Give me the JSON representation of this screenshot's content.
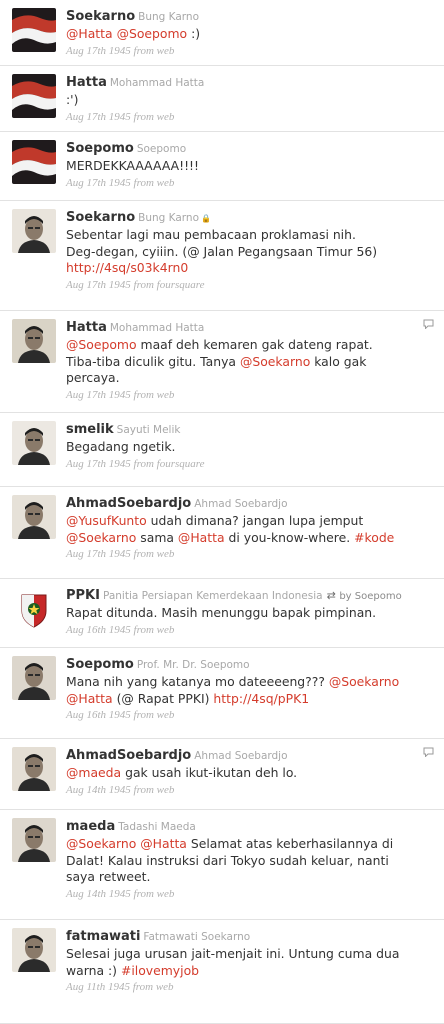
{
  "tweets": [
    {
      "username": "Soekarno",
      "fullname": "Bung Karno",
      "parts": [
        {
          "t": "mention",
          "v": "@Hatta"
        },
        {
          "t": "text",
          "v": " "
        },
        {
          "t": "mention",
          "v": "@Soepomo"
        },
        {
          "t": "text",
          "v": " :)"
        }
      ],
      "meta": "Aug 17th 1945 from web",
      "avatar": "flag-avatar"
    },
    {
      "username": "Hatta",
      "fullname": "Mohammad Hatta",
      "parts": [
        {
          "t": "text",
          "v": ":')"
        }
      ],
      "meta": "Aug 17th 1945 from web",
      "avatar": "flag-avatar"
    },
    {
      "username": "Soepomo",
      "fullname": "Soepomo",
      "parts": [
        {
          "t": "text",
          "v": "MERDEKKAAAAAA!!!!"
        }
      ],
      "meta": "Aug 17th 1945 from web",
      "avatar": "flag-avatar"
    },
    {
      "username": "Soekarno",
      "fullname": "Bung Karno",
      "locked": true,
      "parts": [
        {
          "t": "text",
          "v": "Sebentar lagi mau pembacaan proklamasi nih.\nDeg-degan, cyiiin. (@ Jalan Pegangsaan Timur 56)\n"
        },
        {
          "t": "link",
          "v": "http://4sq/s03k4rn0"
        }
      ],
      "meta": "Aug 17th 1945 from foursquare",
      "avatar": "portrait-avatar"
    },
    {
      "username": "Hatta",
      "fullname": "Mohammad Hatta",
      "reply": true,
      "parts": [
        {
          "t": "mention",
          "v": "@Soepomo"
        },
        {
          "t": "text",
          "v": " maaf deh kemaren gak dateng rapat.\nTiba-tiba diculik gitu. Tanya "
        },
        {
          "t": "mention",
          "v": "@Soekarno"
        },
        {
          "t": "text",
          "v": " kalo gak\npercaya."
        }
      ],
      "meta": "Aug 17th 1945 from web",
      "avatar": "portrait-avatar"
    },
    {
      "username": "smelik",
      "fullname": "Sayuti Melik",
      "parts": [
        {
          "t": "text",
          "v": "Begadang ngetik."
        }
      ],
      "meta": "Aug 17th 1945 from foursquare",
      "avatar": "portrait-avatar"
    },
    {
      "username": "AhmadSoebardjo",
      "fullname": "Ahmad Soebardjo",
      "parts": [
        {
          "t": "mention",
          "v": "@YusufKunto"
        },
        {
          "t": "text",
          "v": " udah dimana? jangan lupa jemput\n"
        },
        {
          "t": "mention",
          "v": "@Soekarno"
        },
        {
          "t": "text",
          "v": " sama "
        },
        {
          "t": "mention",
          "v": "@Hatta"
        },
        {
          "t": "text",
          "v": " di you-know-where. "
        },
        {
          "t": "hashtag",
          "v": "#kode"
        }
      ],
      "meta": "Aug 17th 1945 from web",
      "avatar": "portrait-avatar"
    },
    {
      "username": "PPKI",
      "fullname": "Panitia Persiapan Kemerdekaan Indonesia",
      "retweet": "by Soepomo",
      "parts": [
        {
          "t": "text",
          "v": "Rapat ditunda. Masih menunggu bapak pimpinan."
        }
      ],
      "meta": "Aug 16th 1945 from web",
      "avatar": "emblem-avatar"
    },
    {
      "username": "Soepomo",
      "fullname": "Prof. Mr. Dr. Soepomo",
      "parts": [
        {
          "t": "text",
          "v": "Mana nih yang katanya mo dateeeeng??? "
        },
        {
          "t": "mention",
          "v": "@Soekarno"
        },
        {
          "t": "text",
          "v": "\n"
        },
        {
          "t": "mention",
          "v": "@Hatta"
        },
        {
          "t": "text",
          "v": " (@ Rapat PPKI) "
        },
        {
          "t": "link",
          "v": "http://4sq/pPK1"
        }
      ],
      "meta": "Aug 16th 1945 from web",
      "avatar": "portrait-avatar"
    },
    {
      "username": "AhmadSoebardjo",
      "fullname": "Ahmad Soebardjo",
      "reply": true,
      "parts": [
        {
          "t": "mention",
          "v": "@maeda"
        },
        {
          "t": "text",
          "v": " gak usah ikut-ikutan deh lo."
        }
      ],
      "meta": "Aug 14th 1945 from web",
      "avatar": "portrait-avatar"
    },
    {
      "username": "maeda",
      "fullname": "Tadashi Maeda",
      "parts": [
        {
          "t": "mention",
          "v": "@Soekarno"
        },
        {
          "t": "text",
          "v": " "
        },
        {
          "t": "mention",
          "v": "@Hatta"
        },
        {
          "t": "text",
          "v": " Selamat atas keberhasilannya di\nDalat! Kalau instruksi dari Tokyo sudah keluar, nanti\nsaya retweet."
        }
      ],
      "meta": "Aug 14th 1945 from web",
      "avatar": "portrait-avatar"
    },
    {
      "username": "fatmawati",
      "fullname": "Fatmawati Soekarno",
      "parts": [
        {
          "t": "text",
          "v": "Selesai juga urusan jait-menjait ini. Untung cuma dua\nwarna :) "
        },
        {
          "t": "hashtag",
          "v": "#ilovemyjob"
        }
      ],
      "meta": "Aug 11th 1945 from web",
      "avatar": "portrait-avatar"
    }
  ],
  "icons": {
    "lock": "lock-icon",
    "retweet": "retweet-icon",
    "reply": "reply-icon"
  },
  "colors": {
    "accent": "#d43c2c",
    "meta": "#b2b2b2",
    "fullname": "#a8a8a8",
    "divider": "#e2e2e2"
  }
}
